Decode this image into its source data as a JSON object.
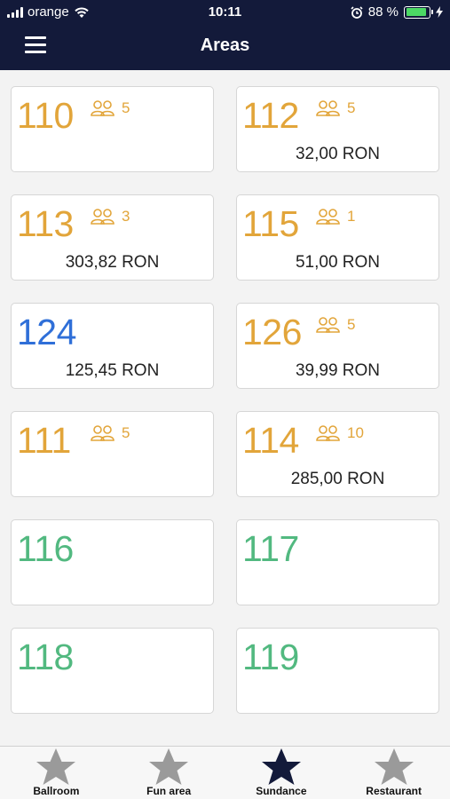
{
  "status_bar": {
    "carrier": "orange",
    "time": "10:11",
    "battery": "88 %",
    "battery_level": 0.88
  },
  "header": {
    "title": "Areas"
  },
  "colors": {
    "occupied": "#e2a53a",
    "highlighted": "#2f6fd8",
    "free": "#52b980",
    "active_tab": "#131a3a",
    "inactive_tab": "#9a9a9a"
  },
  "areas": [
    {
      "number": "110",
      "guests": "5",
      "amount": "",
      "state": "occupied"
    },
    {
      "number": "112",
      "guests": "5",
      "amount": "32,00 RON",
      "state": "occupied"
    },
    {
      "number": "113",
      "guests": "3",
      "amount": "303,82 RON",
      "state": "occupied"
    },
    {
      "number": "115",
      "guests": "1",
      "amount": "51,00 RON",
      "state": "occupied"
    },
    {
      "number": "124",
      "guests": "",
      "amount": "125,45 RON",
      "state": "highlighted"
    },
    {
      "number": "126",
      "guests": "5",
      "amount": "39,99 RON",
      "state": "occupied"
    },
    {
      "number": "111",
      "guests": "5",
      "amount": "",
      "state": "occupied"
    },
    {
      "number": "114",
      "guests": "10",
      "amount": "285,00 RON",
      "state": "occupied"
    },
    {
      "number": "116",
      "guests": "",
      "amount": "",
      "state": "free"
    },
    {
      "number": "117",
      "guests": "",
      "amount": "",
      "state": "free"
    },
    {
      "number": "118",
      "guests": "",
      "amount": "",
      "state": "free"
    },
    {
      "number": "119",
      "guests": "",
      "amount": "",
      "state": "free"
    }
  ],
  "tabs": [
    {
      "label": "Ballroom",
      "icon": "star-icon",
      "active": false
    },
    {
      "label": "Fun area",
      "icon": "star-icon",
      "active": false
    },
    {
      "label": "Sundance",
      "icon": "star-icon",
      "active": true
    },
    {
      "label": "Restaurant",
      "icon": "star-icon",
      "active": false
    }
  ]
}
